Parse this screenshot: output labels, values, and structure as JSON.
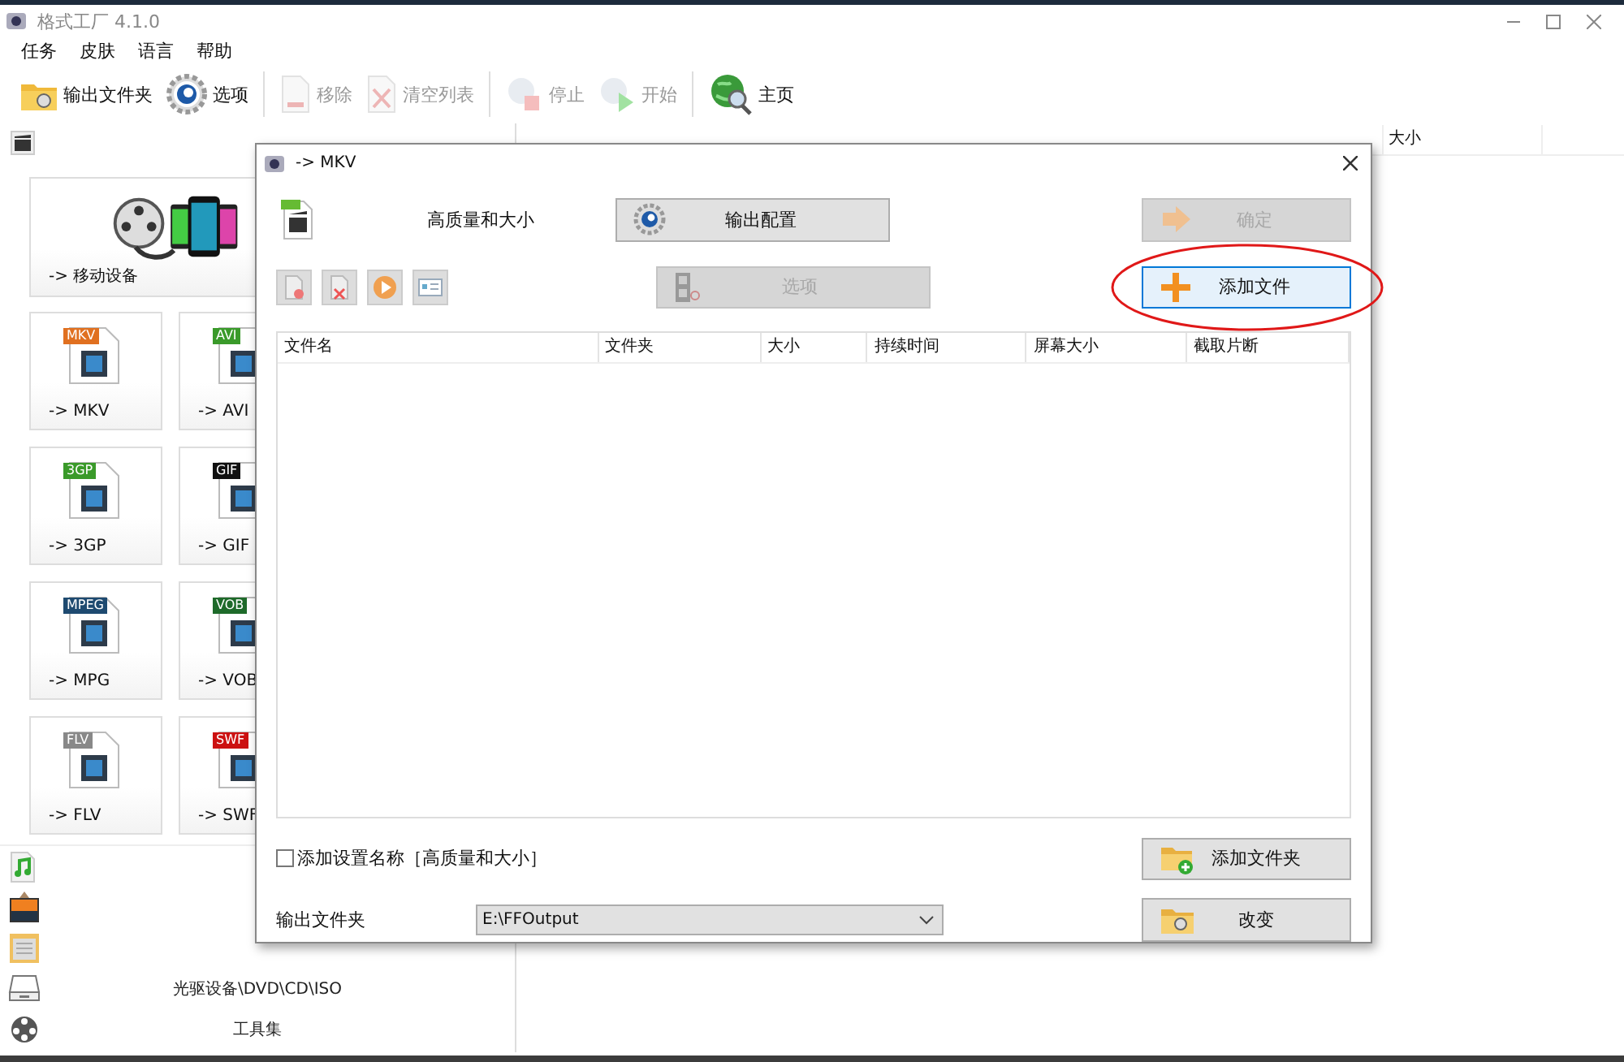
{
  "window": {
    "title": "格式工厂 4.1.0"
  },
  "menu": [
    {
      "label": "任务"
    },
    {
      "label": "皮肤"
    },
    {
      "label": "语言"
    },
    {
      "label": "帮助"
    }
  ],
  "toolbar": [
    {
      "kind": "folder",
      "label": "输出文件夹",
      "disabled": false
    },
    {
      "kind": "gear",
      "label": "选项",
      "disabled": false
    },
    {
      "kind": "remove",
      "label": "移除",
      "disabled": true
    },
    {
      "kind": "clear",
      "label": "清空列表",
      "disabled": true
    },
    {
      "kind": "stop",
      "label": "停止",
      "disabled": true
    },
    {
      "kind": "start",
      "label": "开始",
      "disabled": true
    },
    {
      "kind": "home",
      "label": "主页",
      "disabled": false
    }
  ],
  "sidebar": {
    "featured": {
      "label": "-> 移动设备"
    },
    "tiles": [
      {
        "label": "-> MKV",
        "tag": "MKV",
        "color": "#e07020"
      },
      {
        "label": "-> AVI",
        "tag": "AVI",
        "color": "#3a9a2a"
      },
      {
        "label": "-> 3GP",
        "tag": "3GP",
        "color": "#3a9a2a"
      },
      {
        "label": "-> GIF",
        "tag": "GIF",
        "color": "#111111"
      },
      {
        "label": "-> MPG",
        "tag": "MPEG",
        "color": "#1e4a70"
      },
      {
        "label": "-> VOB",
        "tag": "VOB",
        "color": "#1e6a2a"
      },
      {
        "label": "-> FLV",
        "tag": "FLV",
        "color": "#888888"
      },
      {
        "label": "-> SWF",
        "tag": "SWF",
        "color": "#cc1111"
      }
    ],
    "categories": [
      {
        "kind": "music"
      },
      {
        "kind": "picture"
      },
      {
        "kind": "document"
      },
      {
        "kind": "disc",
        "label": "光驱设备\\DVD\\CD\\ISO"
      },
      {
        "kind": "tools",
        "label": "工具集"
      }
    ]
  },
  "task_list": {
    "columns": [
      "大小"
    ]
  },
  "dialog": {
    "title": "-> MKV",
    "preset": "高质量和大小",
    "output_settings_button": {
      "label": "输出配置",
      "disabled": false
    },
    "ok_button": {
      "label": "确定",
      "disabled": true
    },
    "tool_buttons": [
      {
        "kind": "remove"
      },
      {
        "kind": "clear"
      },
      {
        "kind": "play"
      },
      {
        "kind": "info"
      }
    ],
    "options_button": {
      "label": "选项",
      "disabled": true
    },
    "add_file_button": {
      "label": "添加文件",
      "highlighted": true
    },
    "file_table": {
      "columns": [
        "文件名",
        "文件夹",
        "大小",
        "持续时间",
        "屏幕大小",
        "截取片断"
      ]
    },
    "add_name_checkbox": {
      "label": "添加设置名称［高质量和大小］",
      "checked": false
    },
    "add_folder_button": {
      "label": "添加文件夹"
    },
    "output_folder": {
      "label": "输出文件夹",
      "value": "E:\\FFOutput"
    },
    "change_button": {
      "label": "改变"
    }
  },
  "annotations": [
    {
      "kind": "ellipse"
    }
  ]
}
